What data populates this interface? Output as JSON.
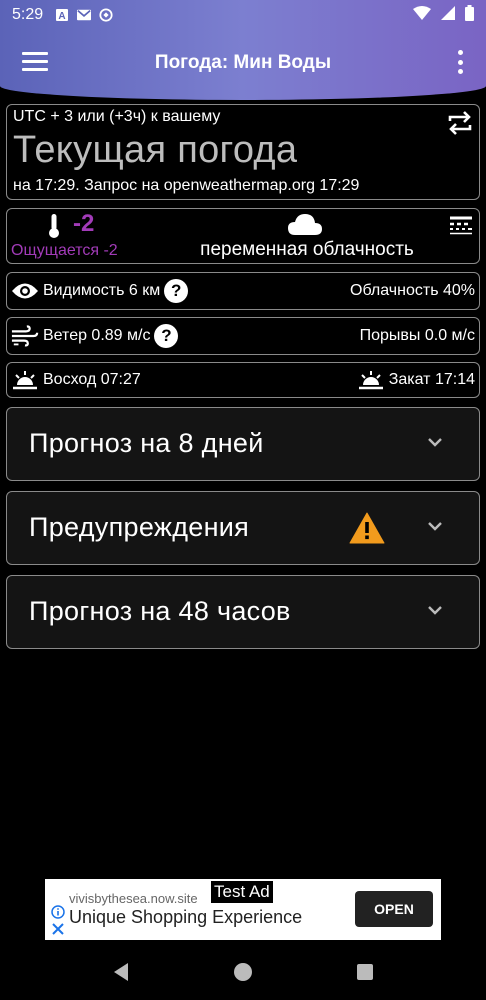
{
  "status_bar": {
    "time": "5:29",
    "icons": [
      "text-notification-icon",
      "gmail-icon",
      "vpn-icon",
      "wifi-icon",
      "signal-icon",
      "battery-icon"
    ]
  },
  "app_bar": {
    "title": "Погода: Мин Воды"
  },
  "current_card": {
    "utc_note": "UTC + 3 или (+3ч) к вашему",
    "title": "Текущая погода",
    "updated": "на 17:29. Запрос на openweathermap.org 17:29"
  },
  "temperature_card": {
    "temp": "-2",
    "feels_like": "Ощущается -2",
    "condition": "переменная облачность"
  },
  "visibility_row": {
    "visibility": "Видимость 6  км",
    "help": "?",
    "cloudiness": "Облачность 40%"
  },
  "wind_row": {
    "wind": "Ветер 0.89 м/с",
    "help": "?",
    "gusts": "Порывы 0.0 м/с"
  },
  "sun_row": {
    "sunrise": "Восход 07:27",
    "sunset": "Закат 17:14"
  },
  "sections": {
    "forecast_8_days": "Прогноз на 8 дней",
    "warnings": "Предупреждения",
    "forecast_48_hours": "Прогноз на 48 часов"
  },
  "ad": {
    "site": "vivisbythesea.now.site",
    "tag": "Test Ad",
    "headline": "Unique Shopping Experience",
    "button": "OPEN"
  },
  "colors": {
    "accent_purple": "#a23bb8",
    "warning_orange": "#f29b1d",
    "header_gradient_start": "#5b63b8",
    "header_gradient_end": "#7a64c4"
  }
}
